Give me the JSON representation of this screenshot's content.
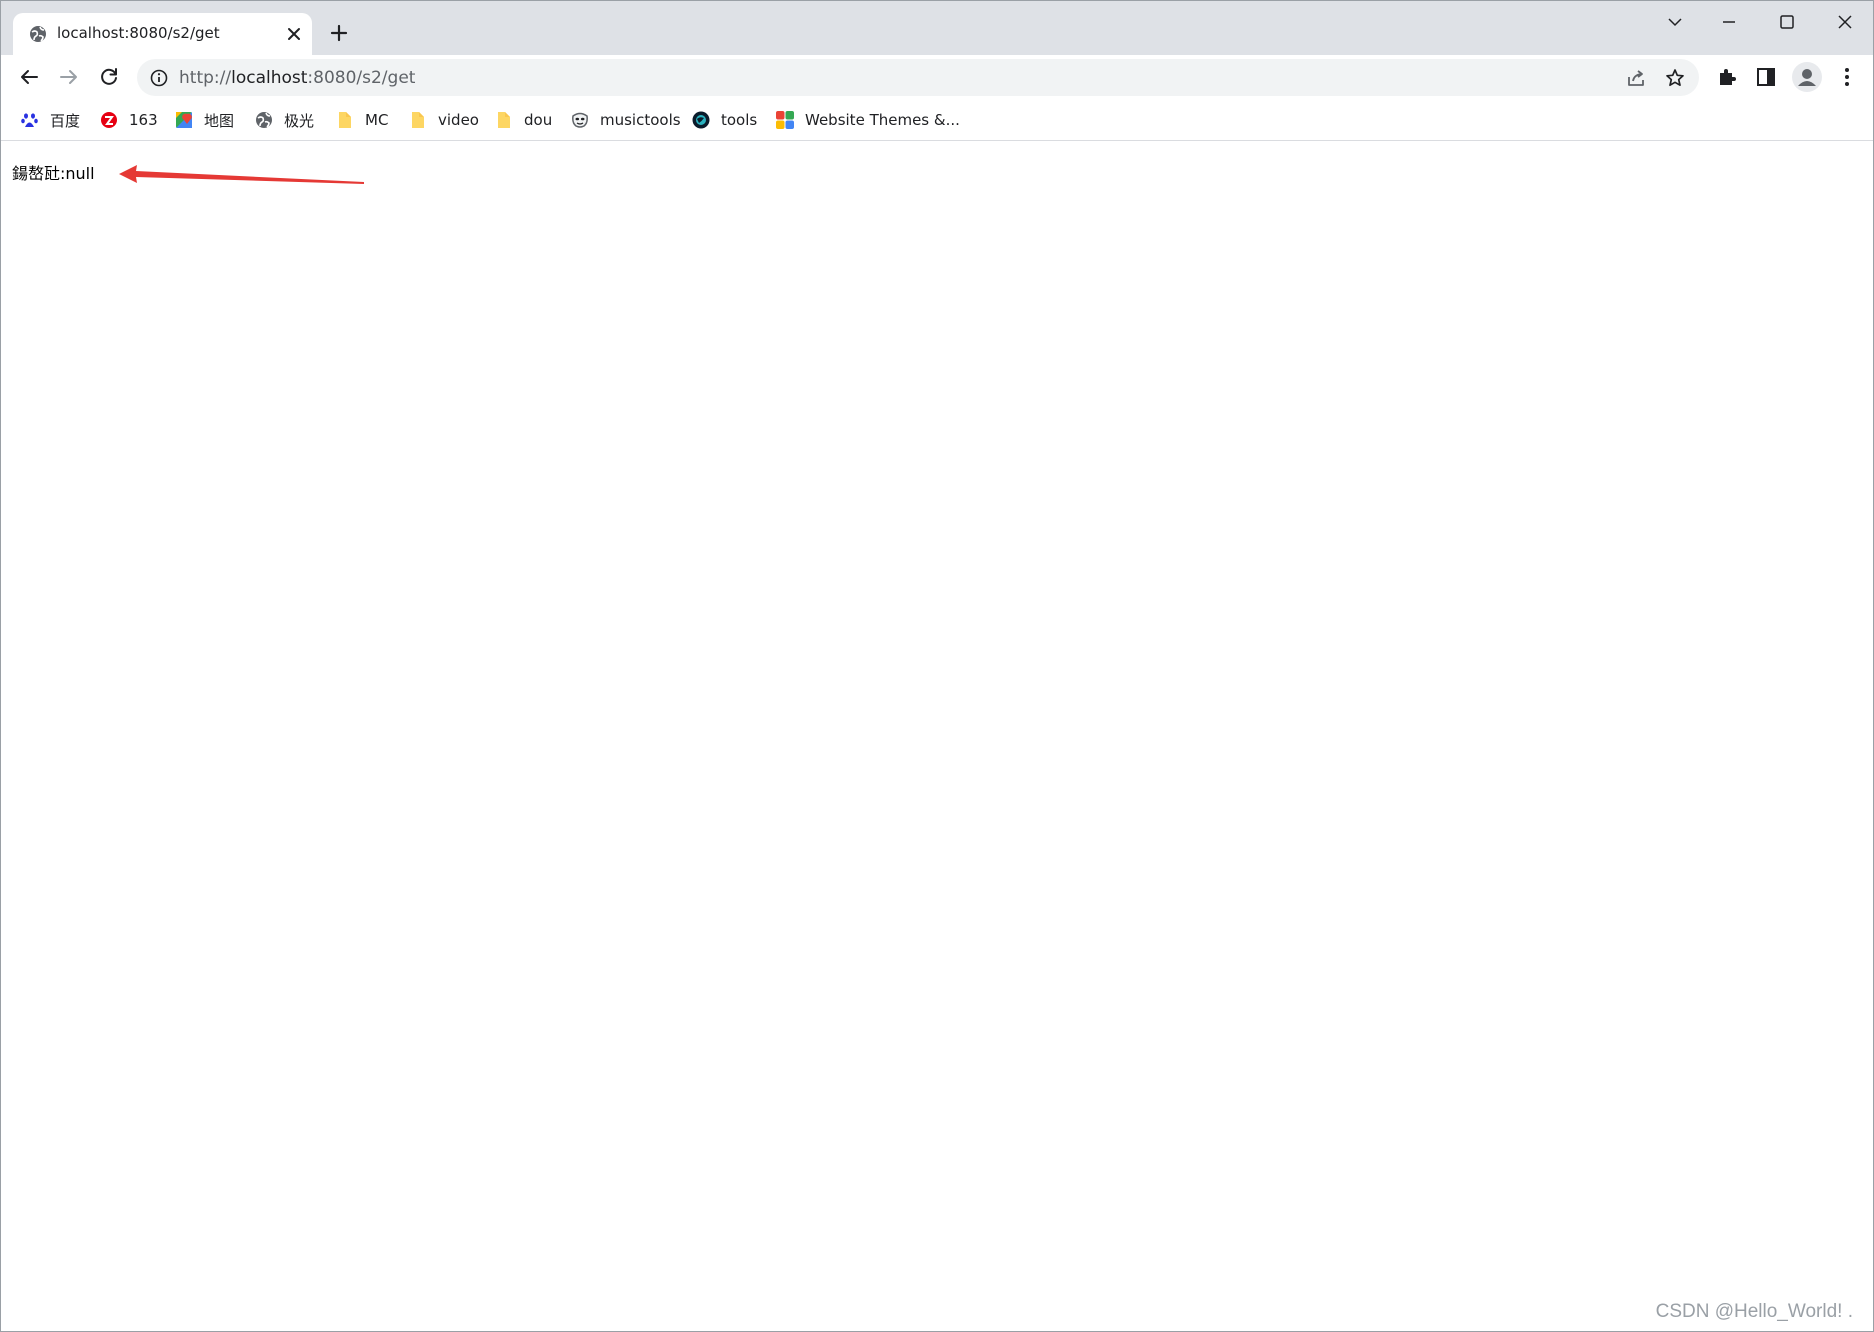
{
  "browser": {
    "tab": {
      "title": "localhost:8080/s2/get",
      "favicon": "globe-icon",
      "close_icon": "close-icon"
    },
    "new_tab_icon": "plus-icon",
    "window_controls": [
      "chevron-down-icon",
      "minimize-icon",
      "maximize-icon",
      "close-icon"
    ],
    "address_bar": {
      "scheme": "http://",
      "host": "localhost",
      "rest": ":8080/s2/get"
    },
    "toolbar_icons": [
      "back-icon",
      "forward-icon",
      "reload-icon",
      "info-icon",
      "share-icon",
      "star-icon",
      "extensions-icon",
      "side-panel-icon",
      "profile-icon",
      "menu-icon"
    ]
  },
  "bookmarks": [
    {
      "label": "百度",
      "icon": "baidu-paw-icon",
      "color": "#2932e1"
    },
    {
      "label": "163",
      "icon": "netease-icon",
      "color": "#e60012"
    },
    {
      "label": "地图",
      "icon": "maps-pin-icon",
      "color": "#34a853"
    },
    {
      "label": "极光",
      "icon": "globe-icon",
      "color": "#5f6368"
    },
    {
      "label": "MC",
      "icon": "folder-icon",
      "color": "#fdd663"
    },
    {
      "label": "video",
      "icon": "folder-icon",
      "color": "#fdd663"
    },
    {
      "label": "dou",
      "icon": "folder-icon",
      "color": "#fdd663"
    },
    {
      "label": "musictools",
      "icon": "mask-icon",
      "color": "#5f6368"
    },
    {
      "label": "tools",
      "icon": "tools-globe-icon",
      "color": "#0b1b2b"
    },
    {
      "label": "Website Themes &...",
      "icon": "themes-grid-icon",
      "color": "#34a853"
    }
  ],
  "page": {
    "text": "鍚嶅瓧:null",
    "annotation_color": "#e53935"
  },
  "watermark": "CSDN @Hello_World! ."
}
